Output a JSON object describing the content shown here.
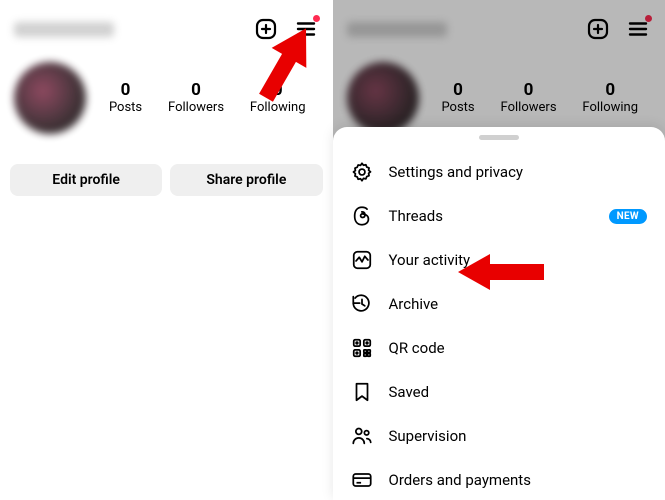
{
  "stats": {
    "posts": {
      "num": "0",
      "label": "Posts"
    },
    "followers": {
      "num": "0",
      "label": "Followers"
    },
    "following": {
      "num": "0",
      "label": "Following"
    }
  },
  "buttons": {
    "edit": "Edit profile",
    "share": "Share profile"
  },
  "menu": {
    "settings": {
      "label": "Settings and privacy"
    },
    "threads": {
      "label": "Threads",
      "badge": "NEW"
    },
    "activity": {
      "label": "Your activity"
    },
    "archive": {
      "label": "Archive"
    },
    "qr": {
      "label": "QR code"
    },
    "saved": {
      "label": "Saved"
    },
    "supervision": {
      "label": "Supervision"
    },
    "orders": {
      "label": "Orders and payments"
    }
  }
}
